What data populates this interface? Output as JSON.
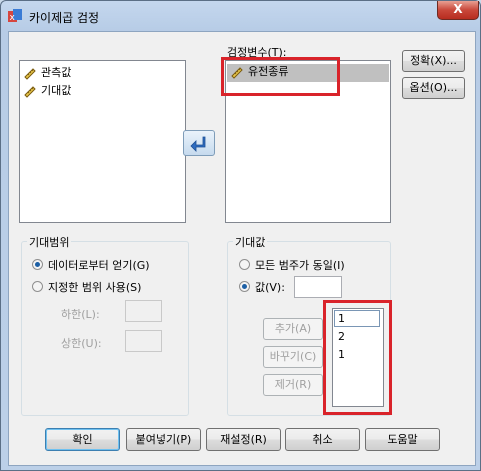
{
  "window": {
    "title": "카이제곱 검정",
    "close_symbol": "X"
  },
  "left_list": {
    "items": [
      "관측값",
      "기대값"
    ]
  },
  "test_vars": {
    "label": "검정변수(T):",
    "items": [
      "유전종류"
    ]
  },
  "side_buttons": {
    "exact": "정확(X)...",
    "options": "옵션(O)..."
  },
  "expected_range": {
    "title": "기대범위",
    "from_data": "데이터로부터 얻기(G)",
    "specified": "지정한 범위 사용(S)",
    "lower": "하한(L):",
    "upper": "상한(U):"
  },
  "expected_values": {
    "title": "기대값",
    "all_equal": "모든 범주가 동일(I)",
    "values": "값(V):",
    "add": "추가(A)",
    "change": "바꾸기(C)",
    "remove": "제거(R)",
    "list": [
      "1",
      "2",
      "1"
    ]
  },
  "footer": {
    "ok": "확인",
    "paste": "붙여넣기(P)",
    "reset": "재설정(R)",
    "cancel": "취소",
    "help": "도움말"
  },
  "colors": {
    "highlight_box": "#d9232a",
    "selection": "#c0c0c0"
  }
}
